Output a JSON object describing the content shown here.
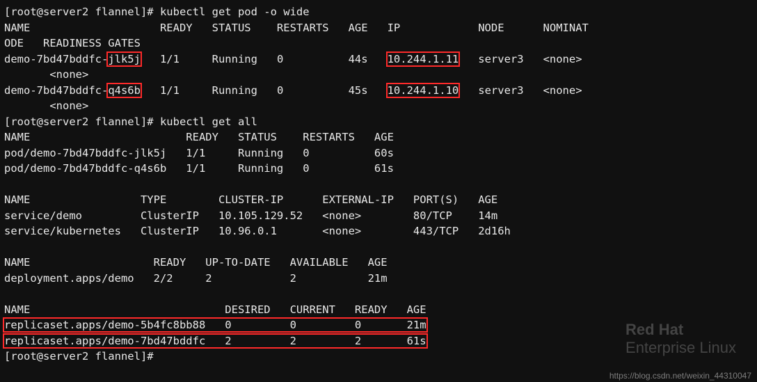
{
  "prompt": "[root@server2 flannel]# ",
  "cmd1": "kubectl get pod -o wide",
  "wide": {
    "hdr": "NAME                    READY   STATUS    RESTARTS   AGE   IP            NODE      NOMINAT",
    "hdr2": "ODE   READINESS GATES",
    "r1a": "demo-7bd47bddfc-",
    "r1b": "jlk5j",
    "r1c": "   1/1     Running   0          44s   ",
    "r1ip": "10.244.1.11",
    "r1d": "   server3   <none>",
    "r1e": "       <none>",
    "r2a": "demo-7bd47bddfc-",
    "r2b": "q4s6b",
    "r2c": "   1/1     Running   0          45s   ",
    "r2ip": "10.244.1.10",
    "r2d": "   server3   <none>",
    "r2e": "       <none>"
  },
  "cmd2": "kubectl get all",
  "pods": {
    "hdr": "NAME                        READY   STATUS    RESTARTS   AGE",
    "r1": "pod/demo-7bd47bddfc-jlk5j   1/1     Running   0          60s",
    "r2": "pod/demo-7bd47bddfc-q4s6b   1/1     Running   0          61s"
  },
  "svc": {
    "hdr": "NAME                 TYPE        CLUSTER-IP      EXTERNAL-IP   PORT(S)   AGE",
    "r1": "service/demo         ClusterIP   10.105.129.52   <none>        80/TCP    14m",
    "r2": "service/kubernetes   ClusterIP   10.96.0.1       <none>        443/TCP   2d16h"
  },
  "dep": {
    "hdr": "NAME                   READY   UP-TO-DATE   AVAILABLE   AGE",
    "r1": "deployment.apps/demo   2/2     2            2           21m"
  },
  "rs": {
    "hdr": "NAME                              DESIRED   CURRENT   READY   AGE",
    "r1": "replicaset.apps/demo-5b4fc8bb88   0         0         0       21m",
    "r2": "replicaset.apps/demo-7bd47bddfc   2         2         2       61s"
  },
  "watermark": {
    "rh1": "Red Hat",
    "rh2": "Enterprise Linux",
    "url": "https://blog.csdn.net/weixin_44310047"
  }
}
